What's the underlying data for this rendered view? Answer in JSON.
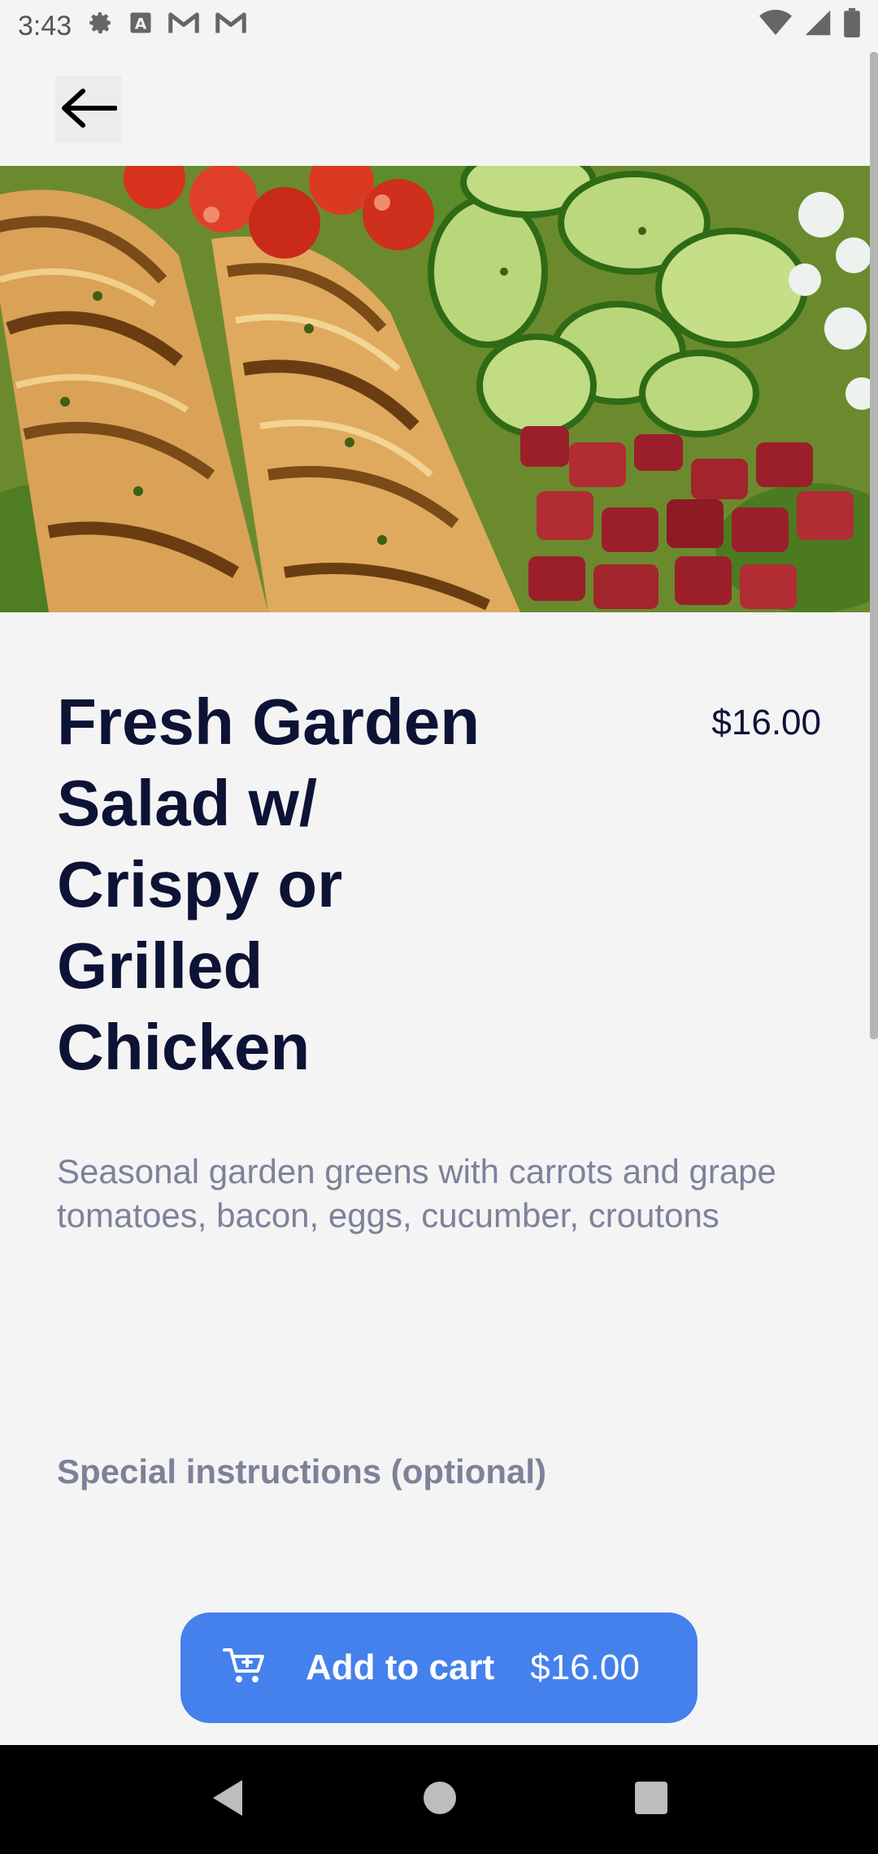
{
  "status_bar": {
    "time": "3:43",
    "icons_left": [
      "gear-icon",
      "font-a-icon",
      "gmail-icon",
      "gmail-icon"
    ],
    "icons_right": [
      "wifi-icon",
      "signal-icon",
      "battery-icon"
    ]
  },
  "header": {
    "back_icon": "arrow-left-icon"
  },
  "item": {
    "image": "salad-with-grilled-chicken-photo",
    "title": "Fresh Garden Salad w/ Crispy or Grilled Chicken",
    "price": "$16.00",
    "description": "Seasonal garden greens with carrots and grape tomatoes, bacon, eggs, cucumber, croutons"
  },
  "special_instructions": {
    "label": "Special instructions (optional)"
  },
  "cart_button": {
    "icon": "cart-plus-icon",
    "label": "Add to cart",
    "price": "$16.00",
    "color": "#4481ec"
  },
  "nav_bar": {
    "icons": [
      "back-triangle-icon",
      "home-circle-icon",
      "recents-square-icon"
    ]
  }
}
